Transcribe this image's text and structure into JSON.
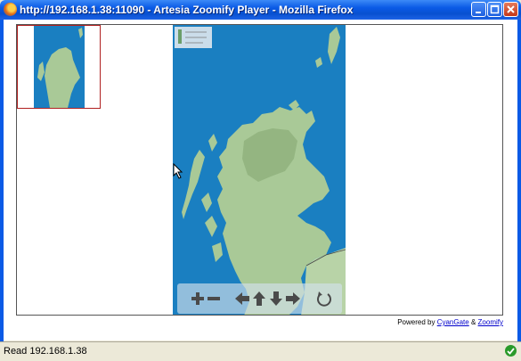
{
  "window": {
    "title": "http://192.168.1.38:11090 - Artesia Zoomify Player - Mozilla Firefox"
  },
  "viewer": {
    "powered_prefix": "Powered by",
    "powered_link1": "CyanGate",
    "powered_amp": "&",
    "powered_link2": "Zoomify",
    "toolbar": {
      "zoom_in_icon": "plus-icon",
      "zoom_out_icon": "minus-icon",
      "pan_left_icon": "arrow-left-icon",
      "pan_up_icon": "arrow-up-icon",
      "pan_down_icon": "arrow-down-icon",
      "pan_right_icon": "arrow-right-icon",
      "reset_icon": "reset-icon"
    },
    "colors": {
      "sea": "#1a7fc1",
      "land": "#a9c997",
      "thumb_border": "#b02020"
    }
  },
  "status": {
    "text": "Read 192.168.1.38"
  }
}
